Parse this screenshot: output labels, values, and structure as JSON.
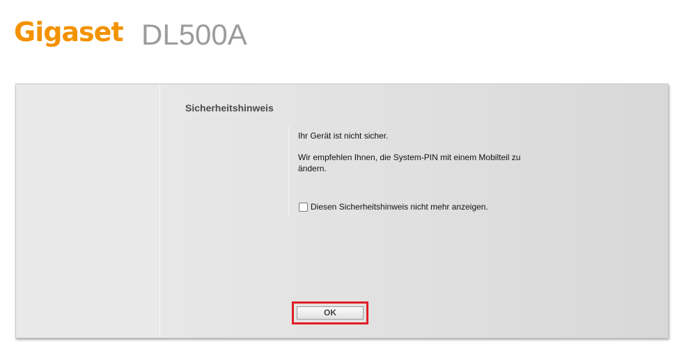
{
  "header": {
    "brand": "Gigaset",
    "model": "DL500A",
    "brand_color": "#f39200"
  },
  "dialog": {
    "title": "Sicherheitshinweis",
    "message_1": "Ihr Gerät ist nicht sicher.",
    "message_2": "Wir empfehlen Ihnen, die System-PIN mit einem Mobilteil zu ändern.",
    "checkbox_label": "Diesen Sicherheitshinweis nicht mehr anzeigen.",
    "checkbox_checked": false,
    "ok_label": "OK",
    "highlight_color": "#e01e26"
  }
}
